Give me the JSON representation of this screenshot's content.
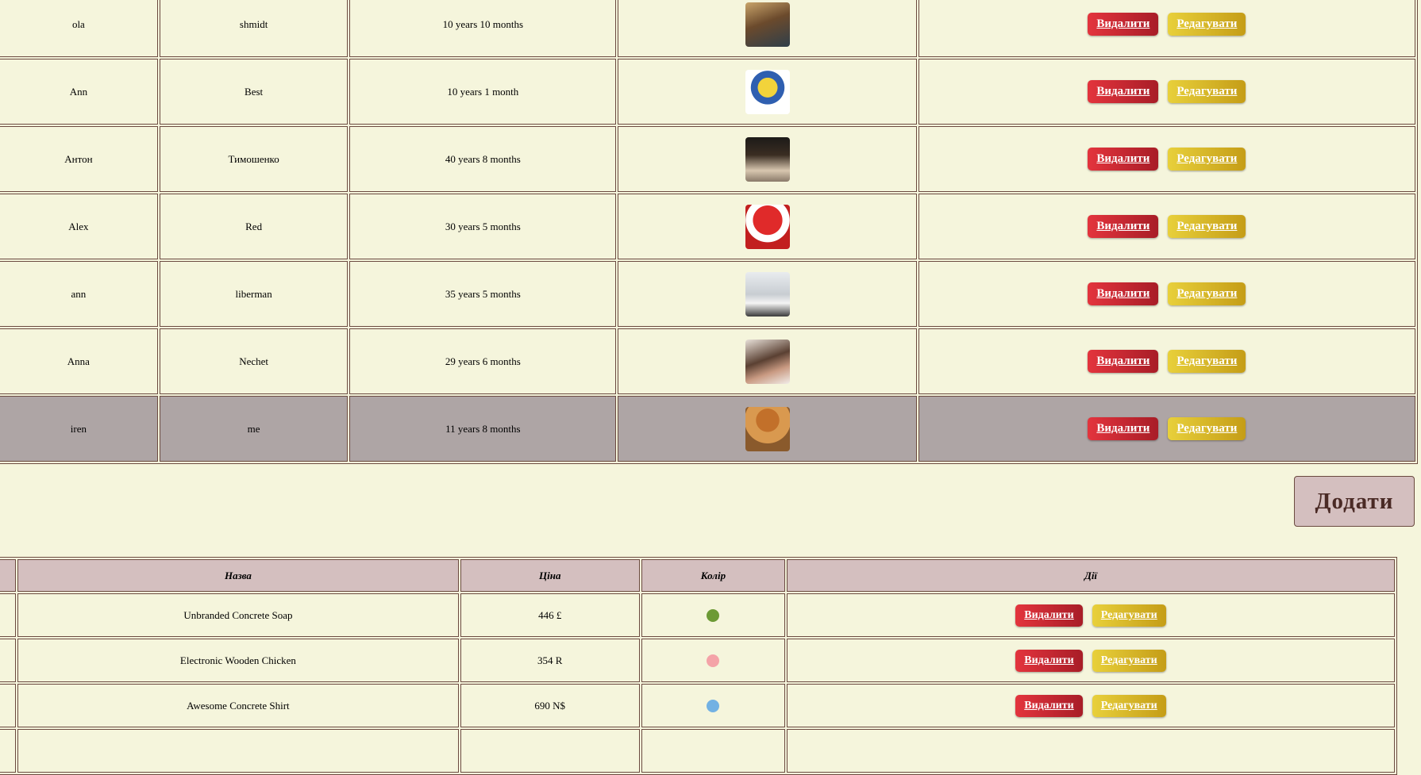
{
  "users": [
    {
      "first_name": "ola",
      "last_name": "shmidt",
      "age": "10 years 10 months",
      "avatar": "avatar-woman-warrior",
      "highlighted": false
    },
    {
      "first_name": "Ann",
      "last_name": "Best",
      "age": "10 years 1 month",
      "avatar": "avatar-yellow-blue-figure",
      "highlighted": false
    },
    {
      "first_name": "Антон",
      "last_name": "Тимошенко",
      "age": "40 years 8 months",
      "avatar": "avatar-man-dark",
      "highlighted": false
    },
    {
      "first_name": "Alex",
      "last_name": "Red",
      "age": "30 years 5 months",
      "avatar": "avatar-anime-red-hair",
      "highlighted": false
    },
    {
      "first_name": "ann",
      "last_name": "liberman",
      "age": "35 years 5 months",
      "avatar": "avatar-woman-office",
      "highlighted": false
    },
    {
      "first_name": "Anna",
      "last_name": "Nechet",
      "age": "29 years 6 months",
      "avatar": "avatar-woman-portrait",
      "highlighted": false
    },
    {
      "first_name": "iren",
      "last_name": "me",
      "age": "11 years 8 months",
      "avatar": "avatar-cat-hat",
      "highlighted": true
    }
  ],
  "actions": {
    "delete_label": "Видалити",
    "edit_label": "Редагувати"
  },
  "add_button_label": "Додати",
  "products": {
    "headers": {
      "name": "Назва",
      "price": "Ціна",
      "color": "Колір",
      "actions": "Дії"
    },
    "rows": [
      {
        "name": "Unbranded Concrete Soap",
        "price": "446 £",
        "color": "#6c9a35"
      },
      {
        "name": "Electronic Wooden Chicken",
        "price": "354 R",
        "color": "#f4a3a8"
      },
      {
        "name": "Awesome Concrete Shirt",
        "price": "690 N$",
        "color": "#72b1e3"
      },
      {
        "name": "",
        "price": "",
        "color": ""
      }
    ]
  },
  "colors": {
    "background": "#f5f5dc",
    "highlight_row": "#aea5a5",
    "header_bg": "#d4bfbf",
    "delete": "#c8252f",
    "edit": "#d9b52a",
    "border": "#6b4a40"
  }
}
